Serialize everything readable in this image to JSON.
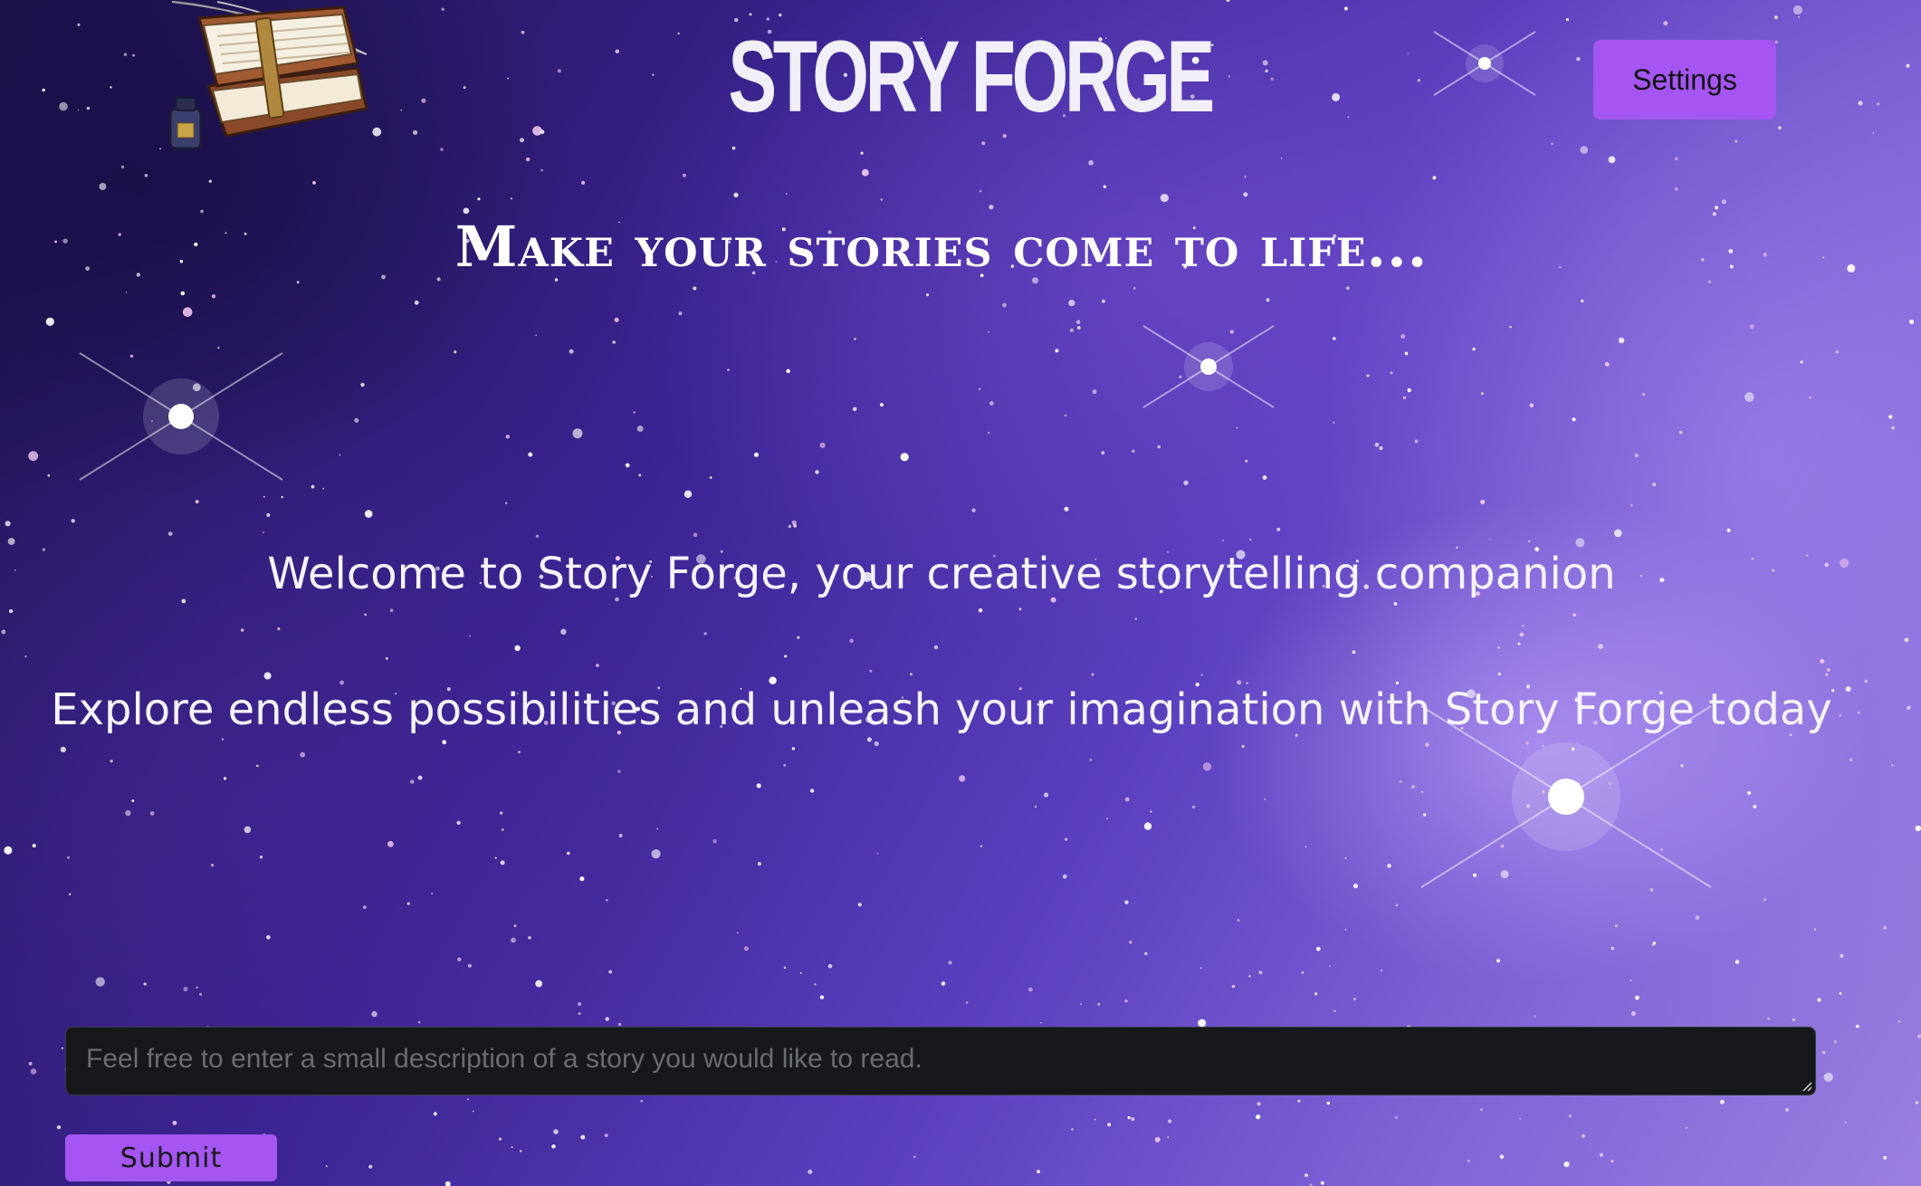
{
  "header": {
    "title": "STORY FORGE",
    "logo_icon": "books-quill-ink-icon",
    "settings_label": "Settings"
  },
  "hero": {
    "tagline": "Make your stories come to life...",
    "welcome": "Welcome to Story Forge, your creative storytelling companion",
    "explore": "Explore endless possibilities and unleash your imagination with Story Forge today"
  },
  "form": {
    "input_value": "",
    "input_placeholder": "Feel free to enter a small description of a story you would like to read.",
    "submit_label": "Submit"
  },
  "colors": {
    "accent": "#a455f2",
    "input_bg": "#17181b",
    "text": "#ffffff"
  }
}
